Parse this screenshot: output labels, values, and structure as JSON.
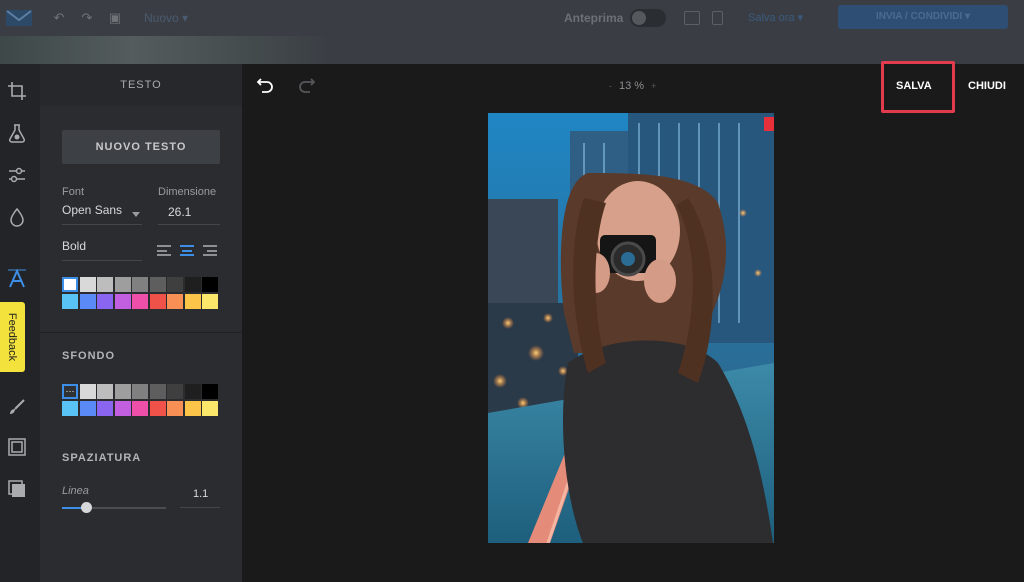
{
  "topbar": {
    "menu_label": "Nuovo",
    "preview_label": "Anteprima",
    "save_link": "Salva ora",
    "cta_label": "INVIA / CONDIVIDI"
  },
  "feedback_label": "Feedback",
  "panel": {
    "title": "TESTO",
    "new_text_button": "NUOVO TESTO",
    "font_label": "Font",
    "font_value": "Open Sans",
    "size_label": "Dimensione",
    "size_value": "26.1",
    "weight_value": "Bold",
    "text_colors": [
      "#ffffff",
      "#d9d9d9",
      "#bdbdbd",
      "#9e9e9e",
      "#808080",
      "#5e5e5e",
      "#3f3f3f",
      "#1f1f1f",
      "#000000",
      "#59c3f5",
      "#5a8af5",
      "#8a65f0",
      "#c25fe0",
      "#ee4fa8",
      "#f0524a",
      "#f88f54",
      "#fcc54a",
      "#fbe86a"
    ],
    "background_section": "SFONDO",
    "background_colors": [
      "#2f3134",
      "#d9d9d9",
      "#bdbdbd",
      "#9e9e9e",
      "#808080",
      "#5e5e5e",
      "#3f3f3f",
      "#1f1f1f",
      "#000000",
      "#59c3f5",
      "#5a8af5",
      "#8a65f0",
      "#c25fe0",
      "#ee4fa8",
      "#f0524a",
      "#f88f54",
      "#fcc54a",
      "#fbe86a"
    ],
    "spacing_section": "SPAZIATURA",
    "line_label": "Linea",
    "line_value": "1.1",
    "line_fraction": 0.24
  },
  "canvas": {
    "zoom_value": "13 %",
    "zoom_minus": "-",
    "zoom_plus": "+",
    "save_button": "SALVA",
    "close_button": "CHIUDI"
  },
  "colors": {
    "accent": "#3d8ee6",
    "highlight": "#e23b4e"
  }
}
